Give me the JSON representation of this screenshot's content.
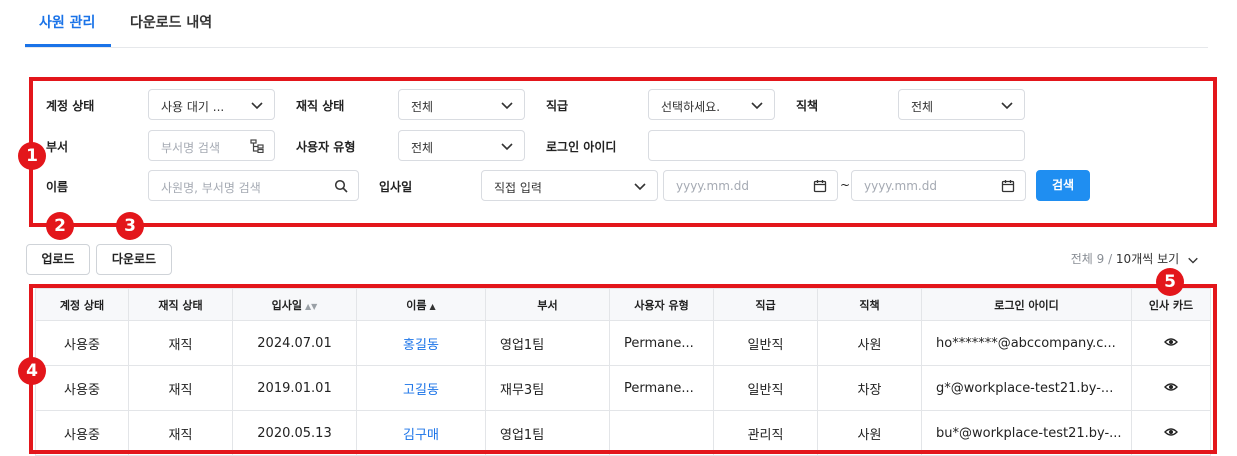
{
  "tabs": [
    {
      "label": "사원 관리",
      "active": true
    },
    {
      "label": "다운로드 내역",
      "active": false
    }
  ],
  "annotations": [
    "1",
    "2",
    "3",
    "4",
    "5"
  ],
  "filters": {
    "account_status": {
      "label": "계정 상태",
      "value": "사용 대기 ..."
    },
    "employment_status": {
      "label": "재직 상태",
      "value": "전체"
    },
    "rank": {
      "label": "직급",
      "value": "선택하세요."
    },
    "position": {
      "label": "직책",
      "value": "전체"
    },
    "department": {
      "label": "부서",
      "placeholder": "부서명 검색"
    },
    "user_type": {
      "label": "사용자 유형",
      "value": "전체"
    },
    "login_id": {
      "label": "로그인 아이디",
      "value": ""
    },
    "name": {
      "label": "이름",
      "placeholder": "사원명, 부서명 검색"
    },
    "hire_date": {
      "label": "입사일",
      "mode": "직접 입력",
      "start_placeholder": "yyyy.mm.dd",
      "separator": "~",
      "end_placeholder": "yyyy.mm.dd"
    },
    "search_label": "검색"
  },
  "actions": {
    "upload": "업로드",
    "download": "다운로드"
  },
  "summary": {
    "total": "전체 9",
    "separator": " / ",
    "per_page": "10개씩 보기"
  },
  "table": {
    "headers": [
      "계정 상태",
      "재직 상태",
      "입사일",
      "이름",
      "부서",
      "사용자 유형",
      "직급",
      "직책",
      "로그인 아이디",
      "인사 카드"
    ],
    "rows": [
      [
        "사용중",
        "재직",
        "2024.07.01",
        "홍길동",
        "영업1팀",
        "Permane...",
        "일반직",
        "사원",
        "ho*******@abccompany.c..."
      ],
      [
        "사용중",
        "재직",
        "2019.01.01",
        "고길동",
        "재무3팀",
        "Permane...",
        "일반직",
        "차장",
        "g*@workplace-test21.by-..."
      ],
      [
        "사용중",
        "재직",
        "2020.05.13",
        "김구매",
        "영업1팀",
        "",
        "관리직",
        "사원",
        "bu*@workplace-test21.by-..."
      ]
    ]
  },
  "icons": {
    "chevron": "chevron-down-icon",
    "search": "search-icon",
    "calendar": "calendar-icon",
    "org": "org-tree-icon",
    "view": "eye-icon"
  },
  "colors": {
    "accent": "#1a73e8",
    "primary_button": "#1f8ef1",
    "annotation": "#e3161b"
  }
}
